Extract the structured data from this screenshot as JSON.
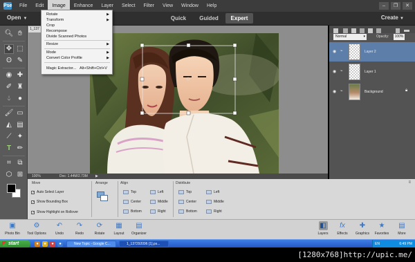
{
  "menubar": {
    "logo": "Pse",
    "items": [
      "File",
      "Edit",
      "Image",
      "Enhance",
      "Layer",
      "Select",
      "Filter",
      "View",
      "Window",
      "Help"
    ],
    "active_index": 2
  },
  "image_menu": {
    "items": [
      {
        "label": "Rotate",
        "submenu": true
      },
      {
        "label": "Transform",
        "submenu": true
      },
      {
        "label": "Crop",
        "submenu": false
      },
      {
        "label": "Recompose",
        "submenu": false
      },
      {
        "label": "Divide Scanned Photos",
        "submenu": false
      },
      {
        "label": "Resize",
        "submenu": true
      },
      {
        "label": "Mode",
        "submenu": true
      },
      {
        "label": "Convert Color Profile",
        "submenu": true
      },
      {
        "label": "Magic Extractor...",
        "shortcut": "Alt+Shift+Ctrl+V",
        "submenu": false
      }
    ]
  },
  "modebar": {
    "open_label": "Open",
    "tabs": [
      "Quick",
      "Guided",
      "Expert"
    ],
    "active_tab": "Expert",
    "create_label": "Create"
  },
  "document": {
    "tab_label": "1_137",
    "zoom": "100%",
    "doc_size": "Doc: 1.44M/2.73M",
    "arrow": "▶"
  },
  "layers_panel": {
    "blend_mode": "Normal",
    "opacity_label": "Opacity:",
    "opacity_value": "100%",
    "layers": [
      {
        "name": "Layer 2",
        "selected": true,
        "thumb": "transparent"
      },
      {
        "name": "Layer 1",
        "selected": false,
        "thumb": "transparent"
      },
      {
        "name": "Background",
        "selected": false,
        "thumb": "photo"
      }
    ]
  },
  "tool_options": {
    "tool_name": "Move",
    "checkboxes": [
      "Auto Select Layer",
      "Show Bounding Box",
      "Show Highlight on Rollover"
    ],
    "arrange_label": "Arrange",
    "align_label": "Align",
    "align_items": [
      "Top",
      "Center",
      "Bottom",
      "Left",
      "Middle",
      "Right"
    ],
    "distribute_label": "Distribute",
    "distribute_items": [
      "Top",
      "Center",
      "Bottom",
      "Left",
      "Middle",
      "Right"
    ]
  },
  "bottom_bar": {
    "left": [
      "Photo Bin",
      "Tool Options",
      "Undo",
      "Redo",
      "Rotate",
      "Layout",
      "Organizer"
    ],
    "right": [
      "Layers",
      "Effects",
      "Graphics",
      "Favorites",
      "More"
    ]
  },
  "taskbar": {
    "start_label": "start",
    "buttons": [
      "New Topic - Google C...",
      "1_137292096 [1].ps..."
    ],
    "lang": "EN",
    "clock": "6:49 PM"
  },
  "watermark": "[1280x768]http://upic.me/",
  "colors": {
    "accent_selected_layer": "#5c7ea8",
    "taskbar_blue": "#2457c6",
    "start_green": "#2d8c2d"
  }
}
